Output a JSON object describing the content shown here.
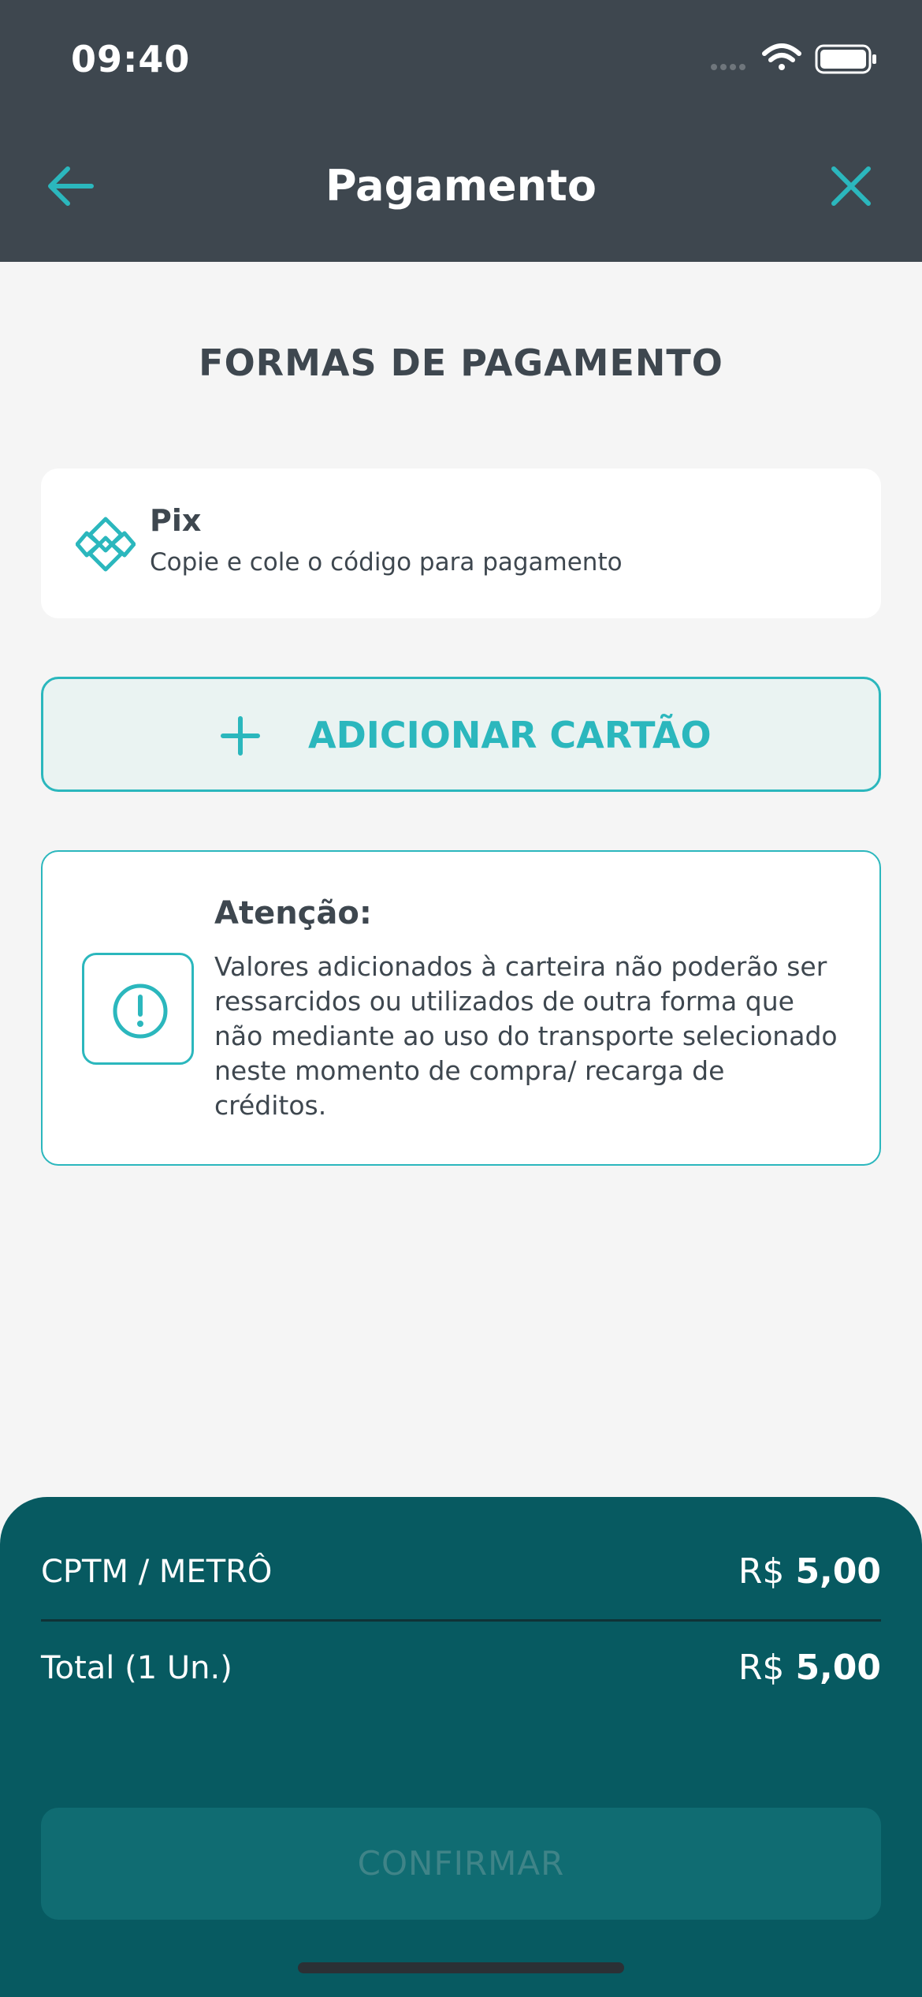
{
  "status_bar": {
    "time": "09:40"
  },
  "header": {
    "title": "Pagamento"
  },
  "section": {
    "title": "FORMAS DE PAGAMENTO"
  },
  "payment_methods": [
    {
      "title": "Pix",
      "subtitle": "Copie e cole o código para pagamento"
    }
  ],
  "add_card": {
    "label": "ADICIONAR CARTÃO"
  },
  "notice": {
    "title": "Atenção:",
    "body": "Valores adicionados à carteira não poderão ser ressarcidos ou utilizados de outra forma que não mediante ao uso do transporte selecionado neste momento de compra/ recarga de créditos."
  },
  "summary": {
    "item": {
      "label": "CPTM / METRÔ",
      "currency": "R$",
      "amount": "5,00"
    },
    "total": {
      "label": "Total (1 Un.)",
      "currency": "R$",
      "amount": "5,00"
    }
  },
  "confirm": {
    "label": "CONFIRMAR",
    "enabled": false
  },
  "colors": {
    "header_bg": "#3e474f",
    "accent": "#2bb7bd",
    "panel_bg": "#075a61",
    "background": "#f5f5f5"
  }
}
